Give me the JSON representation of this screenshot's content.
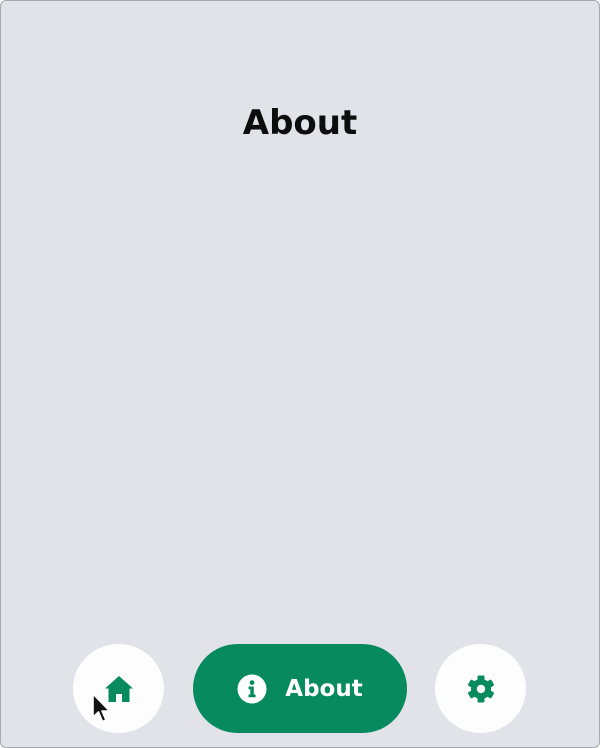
{
  "page": {
    "title": "About"
  },
  "nav": {
    "home": {
      "icon": "home-icon"
    },
    "about": {
      "icon": "info-icon",
      "label": "About"
    },
    "settings": {
      "icon": "gear-icon"
    },
    "active": "about"
  },
  "colors": {
    "background": "#e2e3e8",
    "accent": "#068a5e",
    "nav_button_bg": "#fdfdfd",
    "title_text": "#0d0d0d"
  }
}
